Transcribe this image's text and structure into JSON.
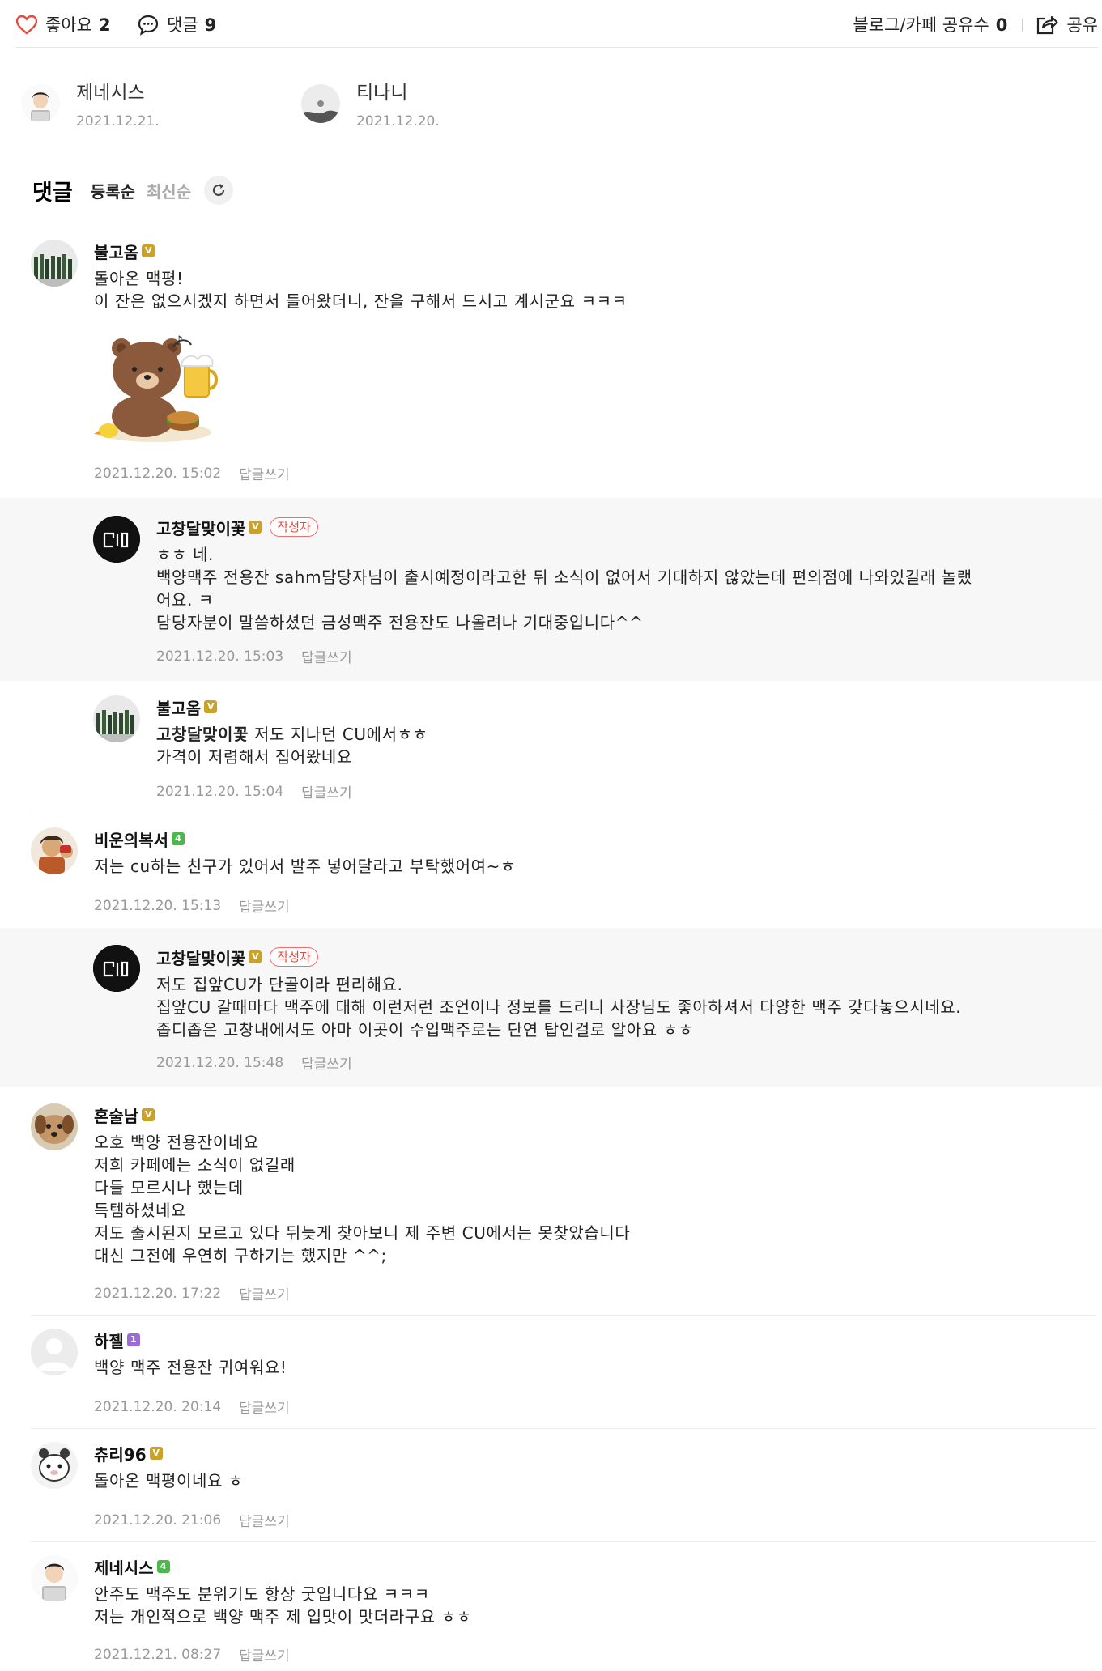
{
  "topbar": {
    "like_label": "좋아요",
    "like_count": "2",
    "comment_label": "댓글",
    "comment_count": "9",
    "share_count_label": "블로그/카페 공유수",
    "share_count": "0",
    "share_label": "공유"
  },
  "likers": [
    {
      "name": "제네시스",
      "date": "2021.12.21."
    },
    {
      "name": "티나니",
      "date": "2021.12.20."
    }
  ],
  "sort": {
    "title": "댓글",
    "option_register": "등록순",
    "option_latest": "최신순"
  },
  "labels": {
    "reply": "답글쓰기",
    "author_badge": "작성자"
  },
  "comments": [
    {
      "nick": "불고옴",
      "text": "돌아온 맥평!\n이 잔은 없으시겠지 하면서 들어왔더니, 잔을 구해서 드시고 계시군요 ㅋㅋㅋ",
      "date": "2021.12.20. 15:02"
    },
    {
      "nick": "고창달맞이꽃",
      "text": "ㅎㅎ 네.\n백양맥주 전용잔 sahm담당자님이 출시예정이라고한 뒤 소식이 없어서 기대하지 않았는데 편의점에 나와있길래 놀랬\n어요. ㅋ\n담당자분이 말씀하셨던 금성맥주 전용잔도 나올려나 기대중입니다^^",
      "date": "2021.12.20. 15:03"
    },
    {
      "nick": "불고옴",
      "tag": "고창달맞이꽃",
      "text": " 저도 지나던 CU에서ㅎㅎ\n가격이 저렴해서 집어왔네요",
      "date": "2021.12.20. 15:04"
    },
    {
      "nick": "비운의복서",
      "text": "저는 cu하는 친구가 있어서 발주 넣어달라고 부탁했어여~ㅎ",
      "date": "2021.12.20. 15:13"
    },
    {
      "nick": "고창달맞이꽃",
      "text": "저도 집앞CU가 단골이라 편리해요.\n집앞CU 갈때마다 맥주에 대해 이런저런 조언이나 정보를 드리니 사장님도 좋아하셔서 다양한 맥주 갖다놓으시네요.\n좁디좁은 고창내에서도 아마 이곳이 수입맥주로는 단연 탑인걸로 알아요 ㅎㅎ",
      "date": "2021.12.20. 15:48"
    },
    {
      "nick": "혼술남",
      "text": "오호 백양 전용잔이네요\n저희 카페에는 소식이 없길래\n다들 모르시나 했는데\n득템하셨네요\n저도 출시된지 모르고 있다 뒤늦게 찾아보니 제 주변 CU에서는 못찾았습니다\n대신 그전에 우연히 구하기는 했지만 ^^;",
      "date": "2021.12.20. 17:22"
    },
    {
      "nick": "하젤",
      "text": "백양 맥주 전용잔 귀여워요!",
      "date": "2021.12.20. 20:14"
    },
    {
      "nick": "츄리96",
      "text": "돌아온 맥평이네요 ㅎ",
      "date": "2021.12.20. 21:06"
    },
    {
      "nick": "제네시스",
      "text": "안주도 맥주도 분위기도 항상 굿입니다요 ㅋㅋㅋ\n저는 개인적으로 백양 맥주 제 입맛이 맛더라구요 ㅎㅎ",
      "date": "2021.12.21. 08:27"
    }
  ],
  "colors": {
    "like_heart": "#e8473c",
    "badge_gold": "#c9a227",
    "badge_green": "#4cb84c",
    "badge_purple": "#9b6bd6",
    "author_badge": "#e8473c",
    "reply_bg": "#f7f7f7"
  }
}
